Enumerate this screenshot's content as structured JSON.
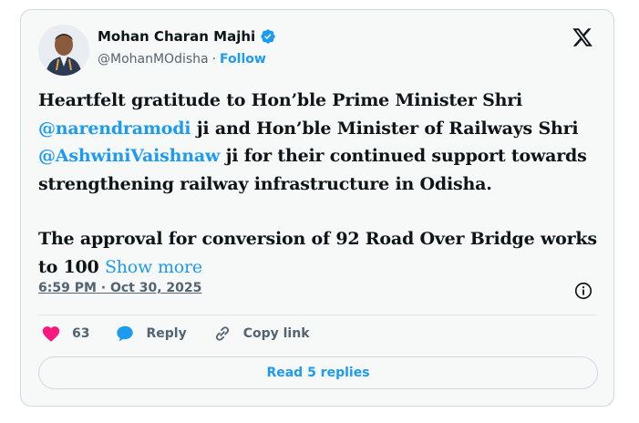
{
  "author": {
    "name": "Mohan Charan Majhi",
    "handle": "@MohanMOdisha",
    "separator": "·",
    "follow_label": "Follow",
    "verified": true
  },
  "tweet": {
    "p1_a": "Heartfelt gratitude to Hon’ble Prime Minister Shri ",
    "mention1": "@narendramodi",
    "p1_b": " ji and Hon’ble Minister of Railways Shri ",
    "mention2": "@AshwiniVaishnaw",
    "p1_c": " ji for their continued support towards strengthening railway infrastructure in Odisha.",
    "p2": "The approval for conversion of 92 Road Over Bridge works to 100 ",
    "show_more": "Show more"
  },
  "meta": {
    "time": "6:59 PM",
    "separator": "·",
    "date": "Oct 30, 2025"
  },
  "actions": {
    "likes_count": "63",
    "reply_label": "Reply",
    "copy_label": "Copy link"
  },
  "read_replies_label": "Read 5 replies",
  "colors": {
    "accent": "#1d9bf0",
    "like": "#f91880",
    "card_bg": "#f7f9f9",
    "border": "#cfd9de"
  },
  "icons": [
    "verified-badge-icon",
    "x-logo-icon",
    "info-icon",
    "heart-icon",
    "reply-icon",
    "link-icon"
  ]
}
